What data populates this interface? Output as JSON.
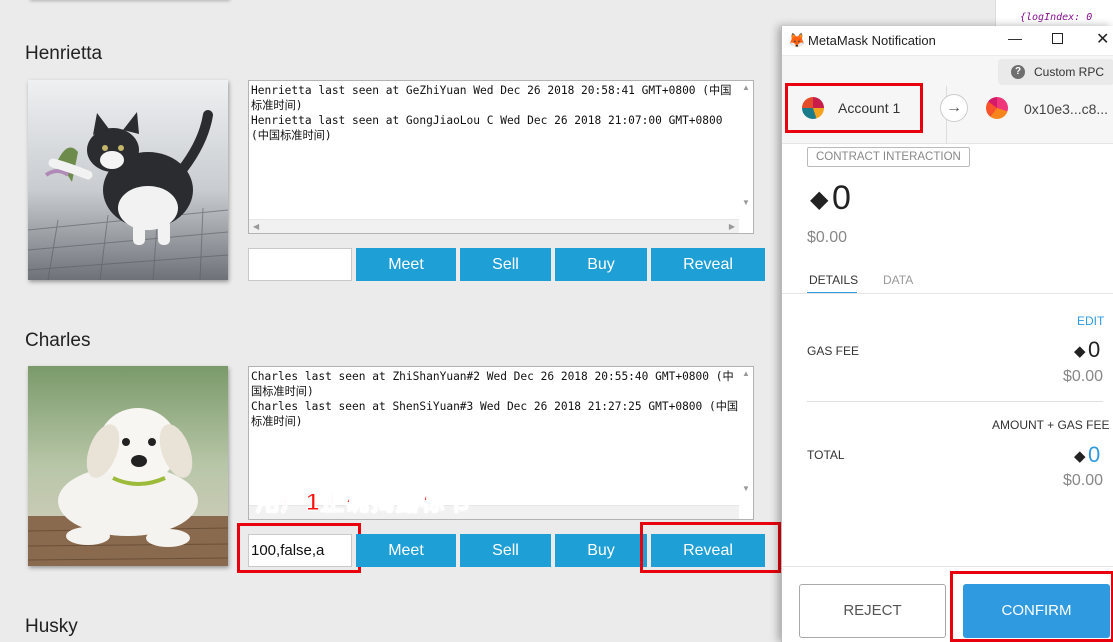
{
  "cards": [
    {
      "name": "Henrietta",
      "photo_desc": "kitten",
      "log": "Henrietta last seen at GeZhiYuan Wed Dec 26 2018 20:58:41 GMT+0800 (中国标准时间)\nHenrietta last seen at GongJiaoLou C Wed Dec 26 2018 21:07:00 GMT+0800 (中国标准时间)",
      "input_value": "",
      "buttons": [
        "Meet",
        "Sell",
        "Buy",
        "Reveal"
      ]
    },
    {
      "name": "Charles",
      "photo_desc": "puppy",
      "log": "Charles last seen at ZhiShanYuan#2 Wed Dec 26 2018 20:55:40 GMT+0800 (中国标准时间)\nCharles last seen at ShenSiYuan#3 Wed Dec 26 2018 21:27:25 GMT+0800 (中国标准时间)",
      "input_value": "100,false,a",
      "buttons": [
        "Meet",
        "Sell",
        "Buy",
        "Reveal"
      ]
    },
    {
      "name": "Husky"
    }
  ],
  "annotation": "用户1正确揭露标书",
  "devtools_snippet": "{logIndex: 0",
  "metamask": {
    "window_title": "MetaMask Notification",
    "network": "Custom RPC",
    "from_account": "Account 1",
    "to_address": "0x10e3...c8...",
    "badge": "CONTRACT INTERACTION",
    "amount": "0",
    "amount_fiat": "$0.00",
    "tabs": [
      "DETAILS",
      "DATA"
    ],
    "edit_label": "EDIT",
    "gas_fee_label": "GAS FEE",
    "gas_fee_value": "0",
    "gas_fee_fiat": "$0.00",
    "amount_gas_label": "AMOUNT + GAS FEE",
    "total_label": "TOTAL",
    "total_value": "0",
    "total_fiat": "$0.00",
    "reject_label": "REJECT",
    "confirm_label": "CONFIRM",
    "colors": {
      "primary": "#2f9ae0",
      "accent_blue": "#1e9fd6",
      "highlight_red": "#e8000c"
    }
  }
}
